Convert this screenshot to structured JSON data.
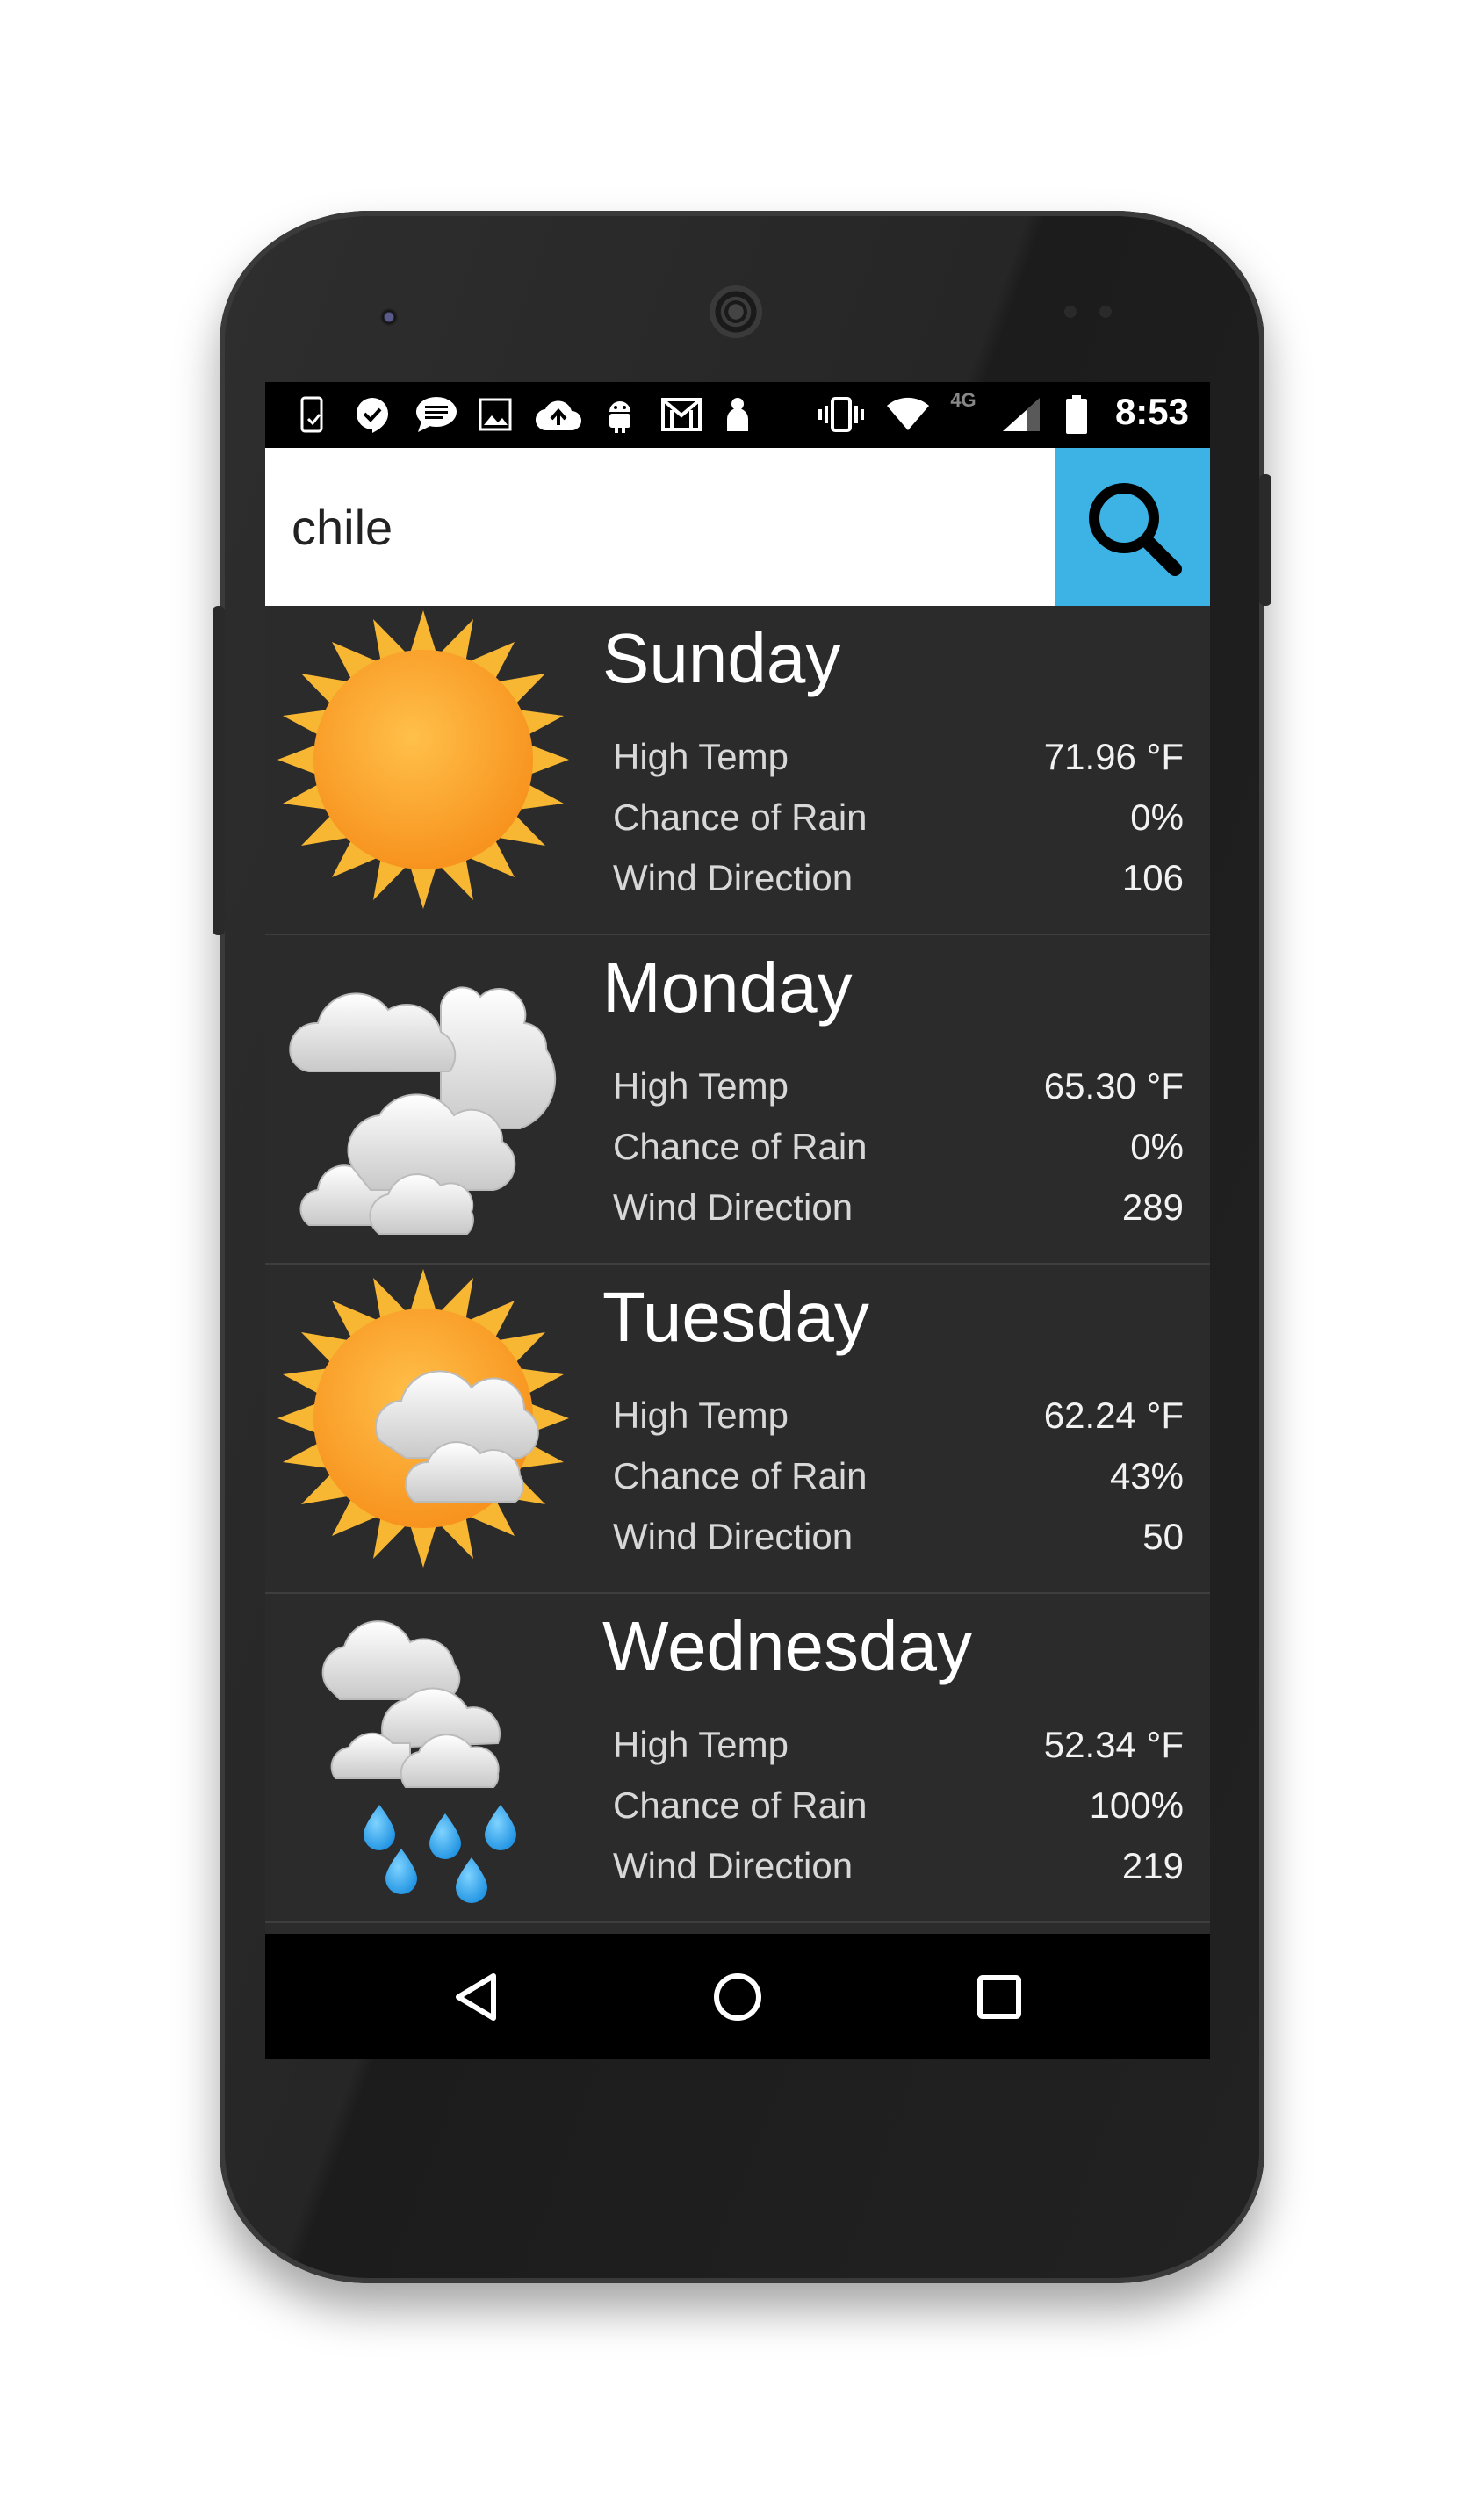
{
  "status_bar": {
    "time": "8:53",
    "network_label": "4G",
    "left_icons": [
      "phone-sync-icon",
      "hangouts-icon",
      "messages-icon",
      "image-icon",
      "cloud-upload-icon",
      "android-icon",
      "gmail-icon",
      "person-icon"
    ],
    "right_icons": [
      "vibrate-icon",
      "wifi-icon",
      "signal-icon",
      "battery-icon"
    ]
  },
  "search": {
    "value": "chile",
    "button_icon": "search-icon",
    "accent_color": "#3db2e5"
  },
  "forecast": [
    {
      "day": "Sunday",
      "icon": "sun-icon",
      "high_temp_label": "High Temp",
      "high_temp": "71.96 °F",
      "rain_label": "Chance of Rain",
      "rain": "0%",
      "wind_label": "Wind Direction",
      "wind": "106"
    },
    {
      "day": "Monday",
      "icon": "cloudy-icon",
      "high_temp_label": "High Temp",
      "high_temp": "65.30 °F",
      "rain_label": "Chance of Rain",
      "rain": "0%",
      "wind_label": "Wind Direction",
      "wind": "289"
    },
    {
      "day": "Tuesday",
      "icon": "partly-cloudy-icon",
      "high_temp_label": "High Temp",
      "high_temp": "62.24 °F",
      "rain_label": "Chance of Rain",
      "rain": "43%",
      "wind_label": "Wind Direction",
      "wind": "50"
    },
    {
      "day": "Wednesday",
      "icon": "rain-icon",
      "high_temp_label": "High Temp",
      "high_temp": "52.34 °F",
      "rain_label": "Chance of Rain",
      "rain": "100%",
      "wind_label": "Wind Direction",
      "wind": "219"
    }
  ],
  "nav_bar": {
    "back_icon": "back-icon",
    "home_icon": "home-icon",
    "recents_icon": "recents-icon"
  }
}
